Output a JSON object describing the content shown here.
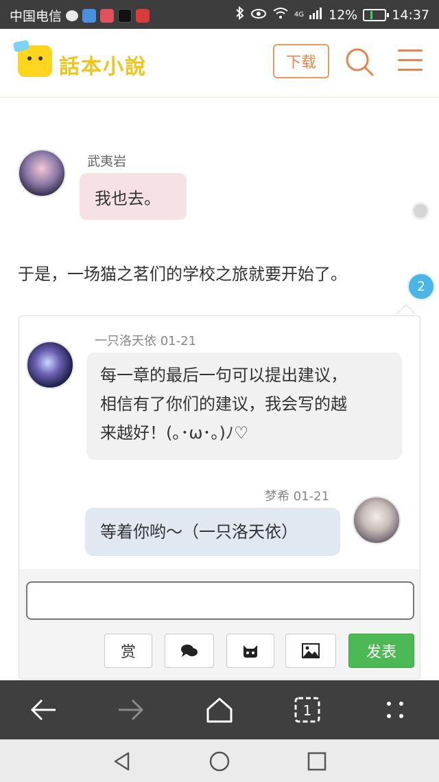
{
  "status_bar": {
    "carrier": "中国电信",
    "network": "4G",
    "battery_percent": "12%",
    "battery_level": 0.12,
    "time": "14:37",
    "icons": [
      "message-icon",
      "app-icon",
      "book-icon",
      "tiktok-icon",
      "huawei-icon",
      "bluetooth-icon",
      "eye-icon",
      "wifi-icon",
      "signal-icon",
      "battery-icon"
    ]
  },
  "header": {
    "logo_text": "話本小說",
    "download_label": "下载"
  },
  "story": {
    "character_name": "武夷岩",
    "character_line": "我也去。",
    "narration": "于是，一场猫之茗们的学校之旅就要开始了。",
    "comment_count": "2"
  },
  "comments": [
    {
      "user": "一只洛天依",
      "date": "01-21",
      "lines": [
        "每一章的最后一句可以提出建议，",
        "相信有了你们的建议，我会写的越",
        "来越好！(｡･ω･｡)ﾉ♡"
      ]
    },
    {
      "user": "梦希",
      "date": "01-21",
      "text": "等着你哟～（一只洛天依）"
    }
  ],
  "composer": {
    "input_value": "",
    "reward_label": "赏",
    "submit_label": "发表"
  },
  "browser_toolbar": {
    "tab_count": "1"
  },
  "colors": {
    "accent": "#e6844f",
    "logo_yellow": "#f0c419",
    "submit_green": "#4cb954",
    "badge_blue": "#4ab5e6",
    "character_bubble": "#f6e2e4",
    "reply_bubble": "#e1e8f1"
  }
}
